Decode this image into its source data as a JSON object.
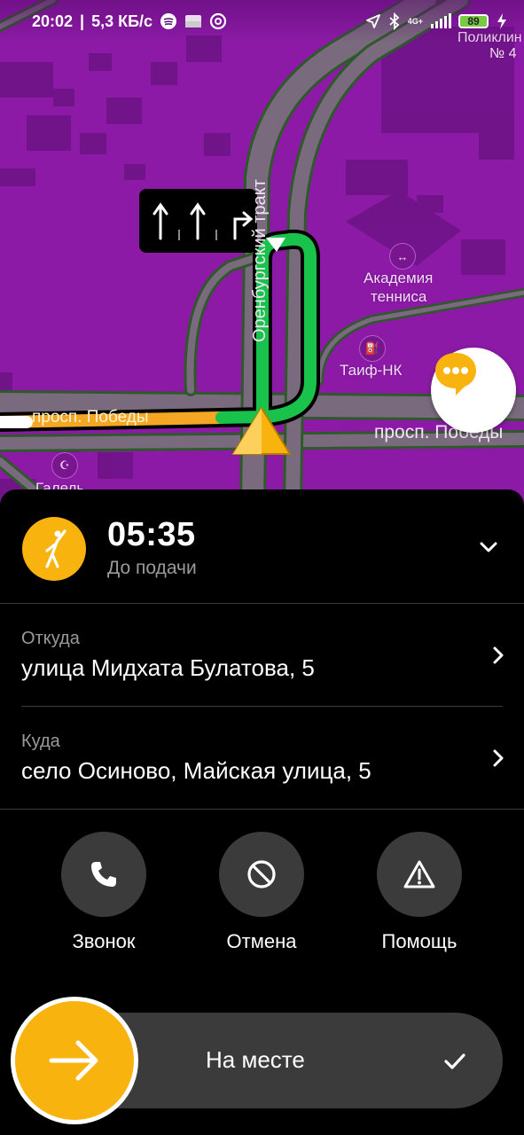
{
  "status_bar": {
    "time": "20:02",
    "speed": "5,3 КБ/с",
    "network": "4G+",
    "battery": "89"
  },
  "map": {
    "labels": {
      "poly": "Поликлин",
      "poly_num": "№ 4",
      "tennis_1": "Академия",
      "tennis_2": "тенниса",
      "taif": "Таиф-НК",
      "galel": "Галель",
      "orenburg": "Оренбургский тракт",
      "pobedy_left": "просп. Победы",
      "pobedy_right": "просп. Победы"
    },
    "route_colors": {
      "free": "#19c24a",
      "slow": "#f5a623",
      "cursor": "#f9b30f"
    }
  },
  "order": {
    "eta_time": "05:35",
    "eta_label": "До подачи",
    "from_label": "Откуда",
    "from_value": "улица Мидхата Булатова, 5",
    "to_label": "Куда",
    "to_value": "село Осиново, Майская улица, 5"
  },
  "actions": {
    "call": "Звонок",
    "cancel": "Отмена",
    "help": "Помощь"
  },
  "slider": {
    "label": "На месте"
  },
  "colors": {
    "accent": "#f9b30f",
    "map_bg": "#8c1aa6",
    "panel": "#000000",
    "button": "#3b3b3b"
  }
}
